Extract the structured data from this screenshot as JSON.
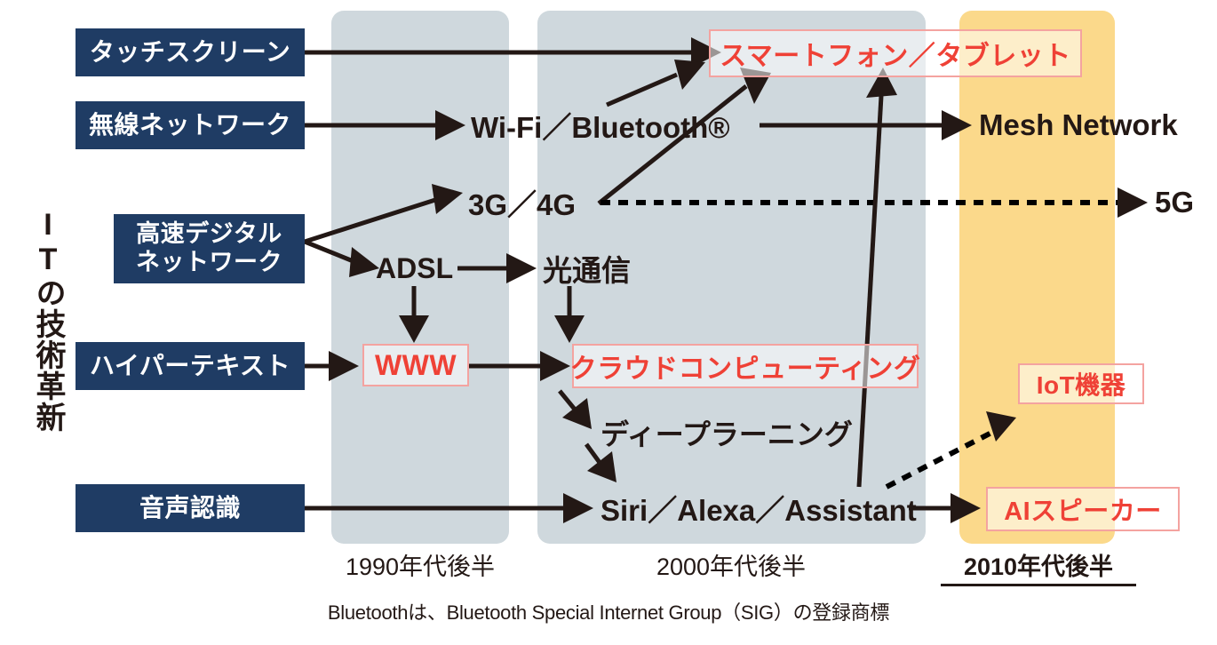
{
  "diagram": {
    "vertical_title": "ITの技術革新",
    "footnote": "Bluetoothは、Bluetooth Special Internet Group（SIG）の登録商標",
    "colors": {
      "navy": "#1f3c64",
      "red": "#ef4136",
      "red_border": "#f4a3a0",
      "band_gray": "#cfd8dd",
      "band_yellow": "#fbd98b",
      "ink": "#231815"
    },
    "source_boxes": [
      {
        "id": "touchscreen",
        "label": "タッチスクリーン"
      },
      {
        "id": "wireless-network",
        "label": "無線ネットワーク"
      },
      {
        "id": "highspeed-digital-network",
        "label": "高速デジタル\nネットワーク"
      },
      {
        "id": "hypertext",
        "label": "ハイパーテキスト"
      },
      {
        "id": "voice-recognition",
        "label": "音声認識"
      }
    ],
    "nodes": [
      {
        "id": "wifi-bluetooth",
        "label": "Wi-Fi／Bluetooth®"
      },
      {
        "id": "mesh-network",
        "label": "Mesh Network"
      },
      {
        "id": "3g-4g",
        "label": "3G／4G"
      },
      {
        "id": "5g",
        "label": "5G"
      },
      {
        "id": "adsl",
        "label": "ADSL"
      },
      {
        "id": "optical-communication",
        "label": "光通信"
      },
      {
        "id": "deep-learning",
        "label": "ディープラーニング"
      },
      {
        "id": "voice-assistants",
        "label": "Siri／Alexa／Assistant"
      }
    ],
    "highlight_boxes": [
      {
        "id": "smartphone-tablet",
        "label": "スマートフォン／タブレット"
      },
      {
        "id": "www",
        "label": "WWW"
      },
      {
        "id": "cloud-computing",
        "label": "クラウドコンピューティング"
      },
      {
        "id": "iot-devices",
        "label": "IoT機器"
      },
      {
        "id": "ai-speaker",
        "label": "AIスピーカー"
      }
    ],
    "eras": [
      {
        "id": "era-1990s-late",
        "label": "1990年代後半",
        "emphasis": false
      },
      {
        "id": "era-2000s-late",
        "label": "2000年代後半",
        "emphasis": false
      },
      {
        "id": "era-2010s-late",
        "label": "2010年代後半",
        "emphasis": true
      }
    ]
  }
}
